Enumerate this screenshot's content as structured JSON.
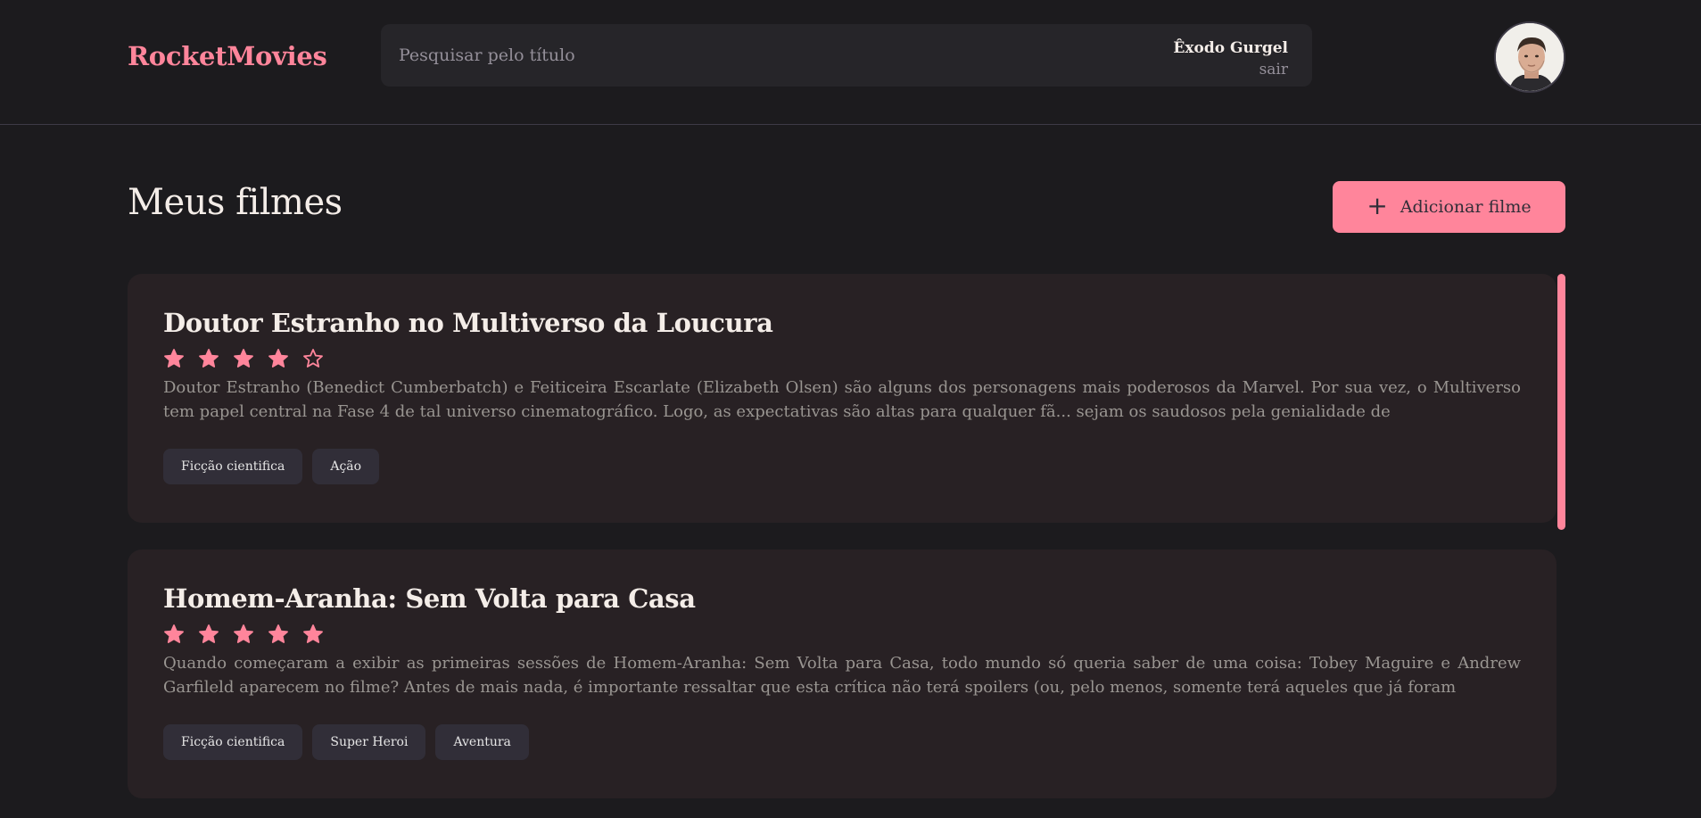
{
  "header": {
    "logo": "RocketMovies",
    "search_placeholder": "Pesquisar pelo título",
    "search_value": "",
    "user_name": "Êxodo Gurgel",
    "logout_label": "sair"
  },
  "main": {
    "title": "Meus filmes",
    "add_button_label": "Adicionar filme",
    "movies": [
      {
        "title": "Doutor Estranho no Multiverso da Loucura",
        "rating": 4,
        "description": "Doutor Estranho (Benedict Cumberbatch) e Feiticeira Escarlate (Elizabeth Olsen) são alguns dos personagens mais poderosos da Marvel. Por sua vez, o Multiverso tem papel central na Fase 4 de tal universo cinematográfico. Logo, as expectativas são altas para qualquer fã... sejam os saudosos pela genialidade de",
        "tags": [
          "Ficção cientifica",
          "Ação"
        ]
      },
      {
        "title": "Homem-Aranha: Sem Volta para Casa",
        "rating": 5,
        "description": "Quando começaram a exibir as primeiras sessões de Homem-Aranha: Sem Volta para Casa, todo mundo só queria saber de uma coisa: Tobey Maguire e Andrew Garfileld aparecem no filme? Antes de mais nada, é importante ressaltar que esta crítica não terá spoilers (ou, pelo menos, somente terá aqueles que já foram",
        "tags": [
          "Ficção cientifica",
          "Super Heroi",
          "Aventura"
        ]
      }
    ]
  },
  "colors": {
    "accent": "#ff859b",
    "background": "#1c1b1e",
    "card": "#282124",
    "tag_bg": "#312e38",
    "muted_text": "#999591"
  },
  "icons": {
    "plus": "plus-icon",
    "star_filled": "star-filled-icon",
    "star_outline": "star-outline-icon",
    "avatar": "user-avatar"
  }
}
